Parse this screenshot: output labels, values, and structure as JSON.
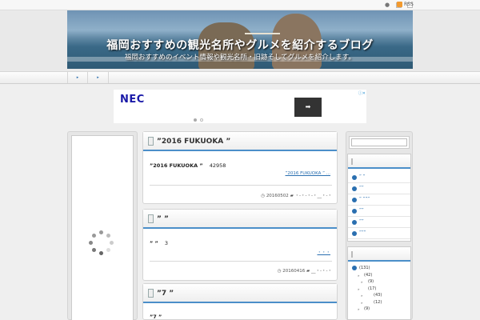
{
  "topbar": {
    "rss_label": "RSS"
  },
  "header": {
    "title": "福岡おすすめの観光名所やグルメを紹介するブログ",
    "subtitle": "福岡おすすめのイベント情報や観光名所・旧跡そしてグルメを紹介します。"
  },
  "nav": {
    "items": [
      "▸",
      "▸"
    ]
  },
  "ad": {
    "brand": "NEC",
    "cta_arrow": "➡",
    "tag": "ⓘ✕"
  },
  "posts": [
    {
      "title": "”2016 FUKUOKA ”",
      "excerpt": "”2016 FUKUOKA ”",
      "number": "42958",
      "link": "”2016 FUKUOKA ” ...",
      "date": "20160502",
      "category": "・-・-・-・__・-・"
    },
    {
      "title": "” ”",
      "excerpt": "” ”",
      "number": "3",
      "link": "・・・",
      "date": "20160416",
      "category": "__・-・-・"
    },
    {
      "title": "”7 ”",
      "excerpt": "”7 ”"
    }
  ],
  "sidebar": {
    "recent": [
      "” ”",
      "””",
      "” ”””",
      "””",
      "””",
      "”””"
    ],
    "categories": [
      {
        "depth": 0,
        "label": "(131)"
      },
      {
        "depth": 1,
        "label": "(42)"
      },
      {
        "depth": 2,
        "label": "(9)"
      },
      {
        "depth": 2,
        "label": "(17)"
      },
      {
        "depth": 3,
        "label": "(43)"
      },
      {
        "depth": 3,
        "label": "(12)"
      },
      {
        "depth": 1,
        "label": "(9)"
      }
    ]
  }
}
